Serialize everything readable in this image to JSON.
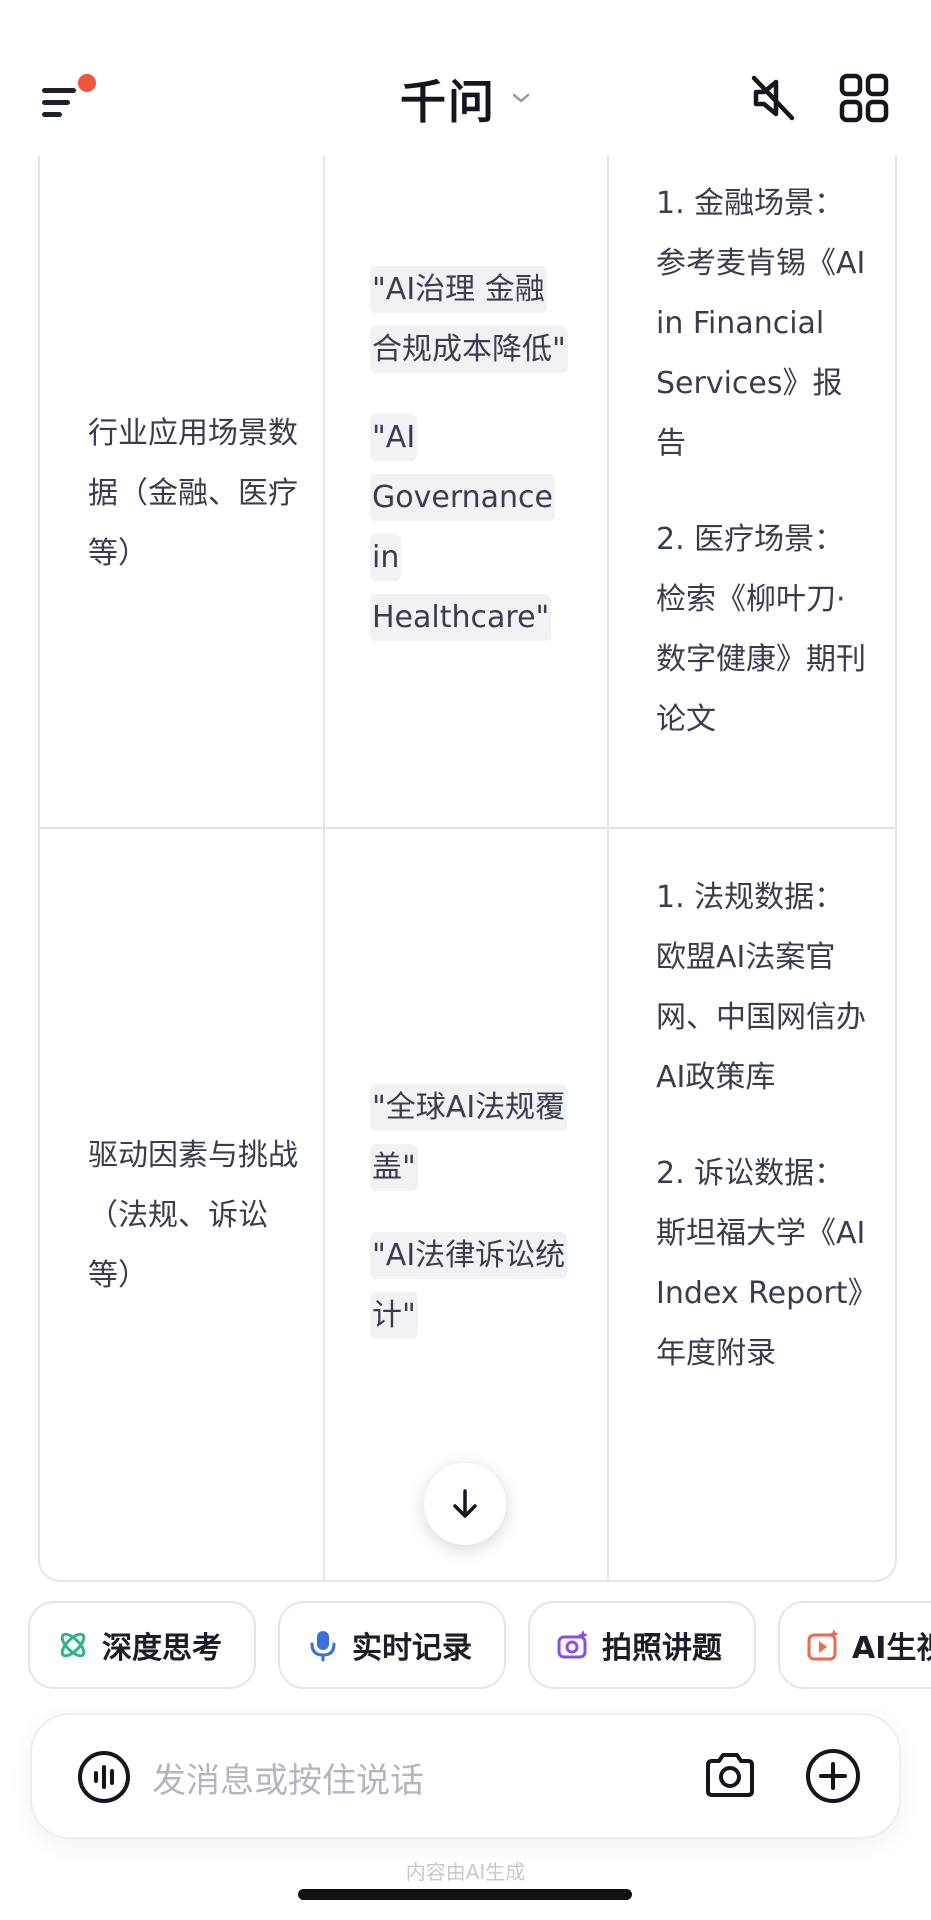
{
  "header": {
    "title": "千问"
  },
  "table": {
    "rows": [
      {
        "dimension": "行业应用场景数据（金融、医疗等）",
        "keywords": [
          "\"AI治理 金融合规成本降低\"",
          "\"AI Governance in Healthcare\""
        ],
        "sources": [
          "1. 金融场景：参考麦肯锡《AI in Financial Services》报告",
          "2. 医疗场景：检索《柳叶刀·数字健康》期刊论文"
        ]
      },
      {
        "dimension": "驱动因素与挑战（法规、诉讼等）",
        "keywords": [
          "\"全球AI法规覆盖\"",
          "\"AI法律诉讼统计\""
        ],
        "sources": [
          "1. 法规数据：欧盟AI法案官网、中国网信办AI政策库",
          "2. 诉讼数据：斯坦福大学《AI Index Report》年度附录"
        ]
      }
    ]
  },
  "chips": [
    {
      "label": "深度思考",
      "icon": "atom-icon",
      "color": "#2fb38a"
    },
    {
      "label": "实时记录",
      "icon": "microphone-icon",
      "color": "#3b6fe0"
    },
    {
      "label": "拍照讲题",
      "icon": "camera-sparkle-icon",
      "color": "#8a4fe0"
    },
    {
      "label": "AI生视频",
      "icon": "video-sparkle-icon",
      "color": "#ee6a4d"
    }
  ],
  "input": {
    "placeholder": "发消息或按住说话"
  },
  "footer_note": "内容由AI生成",
  "colors": {
    "accent_dot": "#f0553a",
    "border": "#e4e5ea",
    "keyword_bg": "#f1f2f4"
  }
}
